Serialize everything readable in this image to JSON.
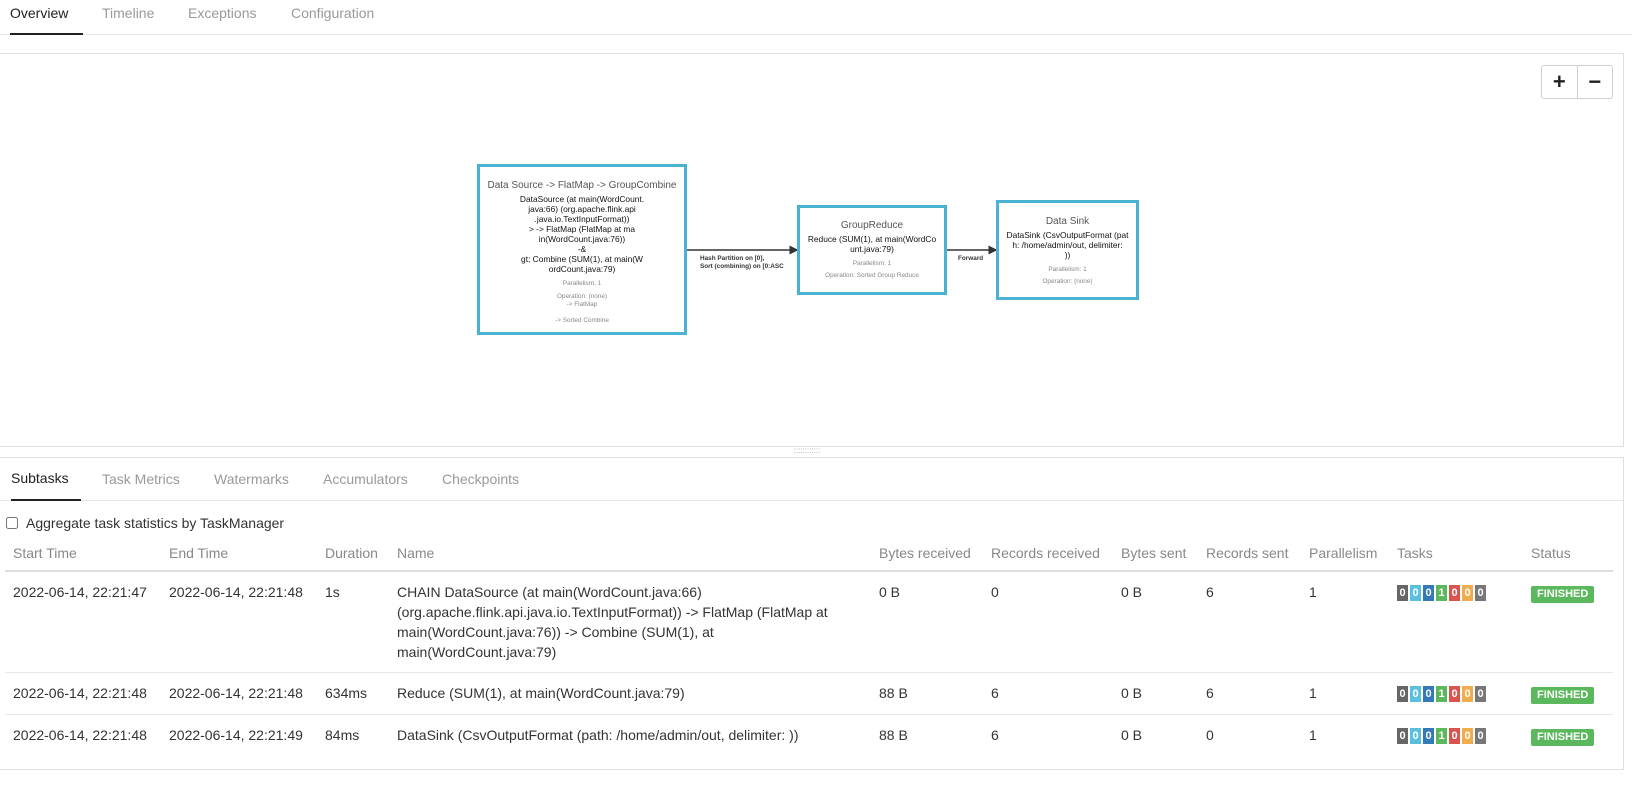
{
  "top_tabs": [
    {
      "label": "Overview",
      "active": true
    },
    {
      "label": "Timeline",
      "active": false
    },
    {
      "label": "Exceptions",
      "active": false
    },
    {
      "label": "Configuration",
      "active": false
    }
  ],
  "graph": {
    "zoom_in": "+",
    "zoom_out": "−",
    "nodes": [
      {
        "title": "Data Source -> FlatMap -> GroupCombine",
        "description": "DataSource (at main(WordCount.\njava:66) (org.apache.flink.api\n.java.io.TextInputFormat))\n> -> FlatMap (FlatMap at ma\nin(WordCount.java:76))\n-&\ngt; Combine (SUM(1), at main(W\nordCount.java:79)",
        "parallelism": "Parallelism: 1",
        "operation": "Operation: (none)\n-> FlatMap\n\n-> Sorted Combine"
      },
      {
        "title": "GroupReduce",
        "description": "Reduce (SUM(1), at main(WordCo\nunt.java:79)",
        "parallelism": "Parallelism: 1",
        "operation": "Operation: Sorted Group Reduce"
      },
      {
        "title": "Data Sink",
        "description": "DataSink (CsvOutputFormat (pat\nh: /home/admin/out, delimiter:\n))",
        "parallelism": "Parallelism: 1",
        "operation": "Operation: (none)"
      }
    ],
    "edges": [
      {
        "label": "Hash Partition on [0],\nSort (combining) on [0:ASC"
      },
      {
        "label": "Forward"
      }
    ]
  },
  "sub_tabs": [
    {
      "label": "Subtasks",
      "active": true
    },
    {
      "label": "Task Metrics",
      "active": false
    },
    {
      "label": "Watermarks",
      "active": false
    },
    {
      "label": "Accumulators",
      "active": false
    },
    {
      "label": "Checkpoints",
      "active": false
    }
  ],
  "aggregate_label": "Aggregate task statistics by TaskManager",
  "table": {
    "headers": [
      "Start Time",
      "End Time",
      "Duration",
      "Name",
      "Bytes received",
      "Records received",
      "Bytes sent",
      "Records sent",
      "Parallelism",
      "Tasks",
      "Status"
    ],
    "task_colors": [
      "#666666",
      "#5bc0de",
      "#337ab7",
      "#5cb85c",
      "#d9534f",
      "#f0ad4e",
      "#777777"
    ],
    "rows": [
      {
        "start": "2022-06-14, 22:21:47",
        "end": "2022-06-14, 22:21:48",
        "duration": "1s",
        "name": "CHAIN DataSource (at main(WordCount.java:66) (org.apache.flink.api.java.io.TextInputFormat)) -> FlatMap (FlatMap at main(WordCount.java:76)) -> Combine (SUM(1), at main(WordCount.java:79)",
        "bytes_received": "0 B",
        "records_received": "0",
        "bytes_sent": "0 B",
        "records_sent": "6",
        "parallelism": "1",
        "tasks": [
          "0",
          "0",
          "0",
          "1",
          "0",
          "0",
          "0"
        ],
        "status": "FINISHED"
      },
      {
        "start": "2022-06-14, 22:21:48",
        "end": "2022-06-14, 22:21:48",
        "duration": "634ms",
        "name": "Reduce (SUM(1), at main(WordCount.java:79)",
        "bytes_received": "88 B",
        "records_received": "6",
        "bytes_sent": "0 B",
        "records_sent": "6",
        "parallelism": "1",
        "tasks": [
          "0",
          "0",
          "0",
          "1",
          "0",
          "0",
          "0"
        ],
        "status": "FINISHED"
      },
      {
        "start": "2022-06-14, 22:21:48",
        "end": "2022-06-14, 22:21:49",
        "duration": "84ms",
        "name": "DataSink (CsvOutputFormat (path: /home/admin/out, delimiter:  ))",
        "bytes_received": "88 B",
        "records_received": "6",
        "bytes_sent": "0 B",
        "records_sent": "0",
        "parallelism": "1",
        "tasks": [
          "0",
          "0",
          "0",
          "1",
          "0",
          "0",
          "0"
        ],
        "status": "FINISHED"
      }
    ]
  }
}
